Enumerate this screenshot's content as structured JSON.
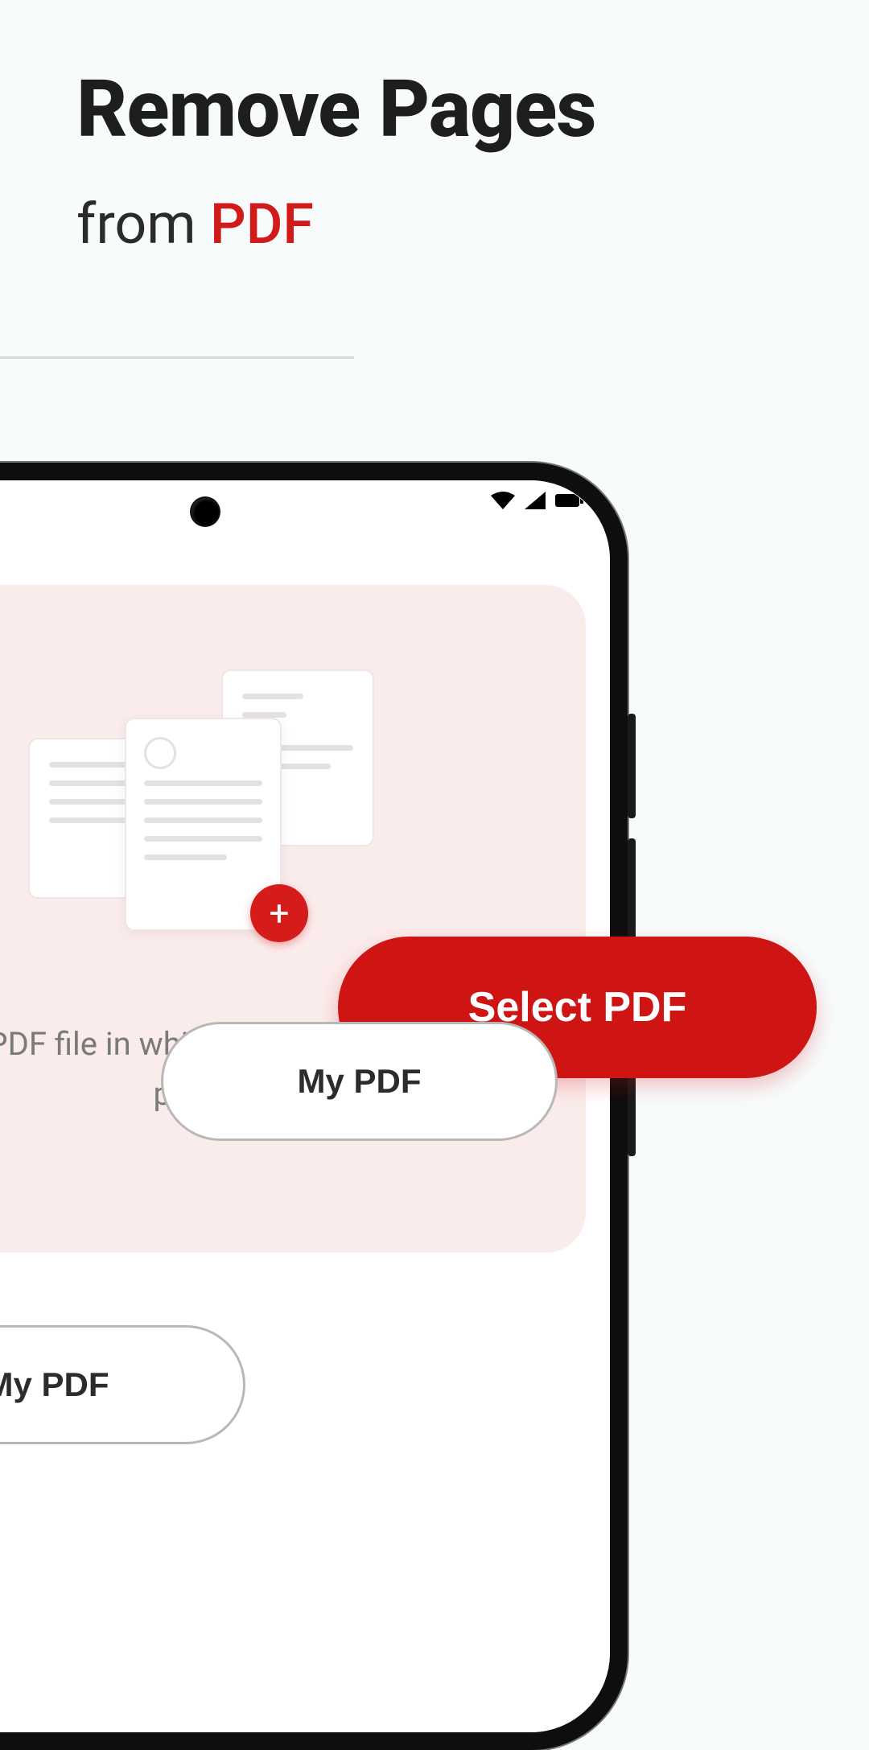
{
  "hero": {
    "title": "Remove Pages",
    "from_word": "from ",
    "pdf_word": "PDF"
  },
  "instruction": "Select PDF file in which you want to remove pages.",
  "buttons": {
    "select_pdf": "Select PDF",
    "my_pdf": "My PDF"
  },
  "icons": {
    "plus": "+"
  }
}
